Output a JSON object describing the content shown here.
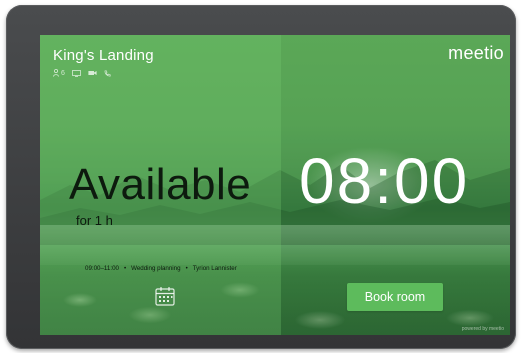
{
  "room": {
    "name": "King's Landing",
    "amenities": [
      {
        "icon": "person-icon",
        "text": "6"
      },
      {
        "icon": "screen-icon",
        "text": ""
      },
      {
        "icon": "camera-icon",
        "text": ""
      },
      {
        "icon": "phone-icon",
        "text": ""
      }
    ]
  },
  "status": {
    "label": "Available",
    "duration": "for 1 h"
  },
  "next_meeting": {
    "time": "09:00–11:00",
    "title": "Wedding planning",
    "organizer": "Tyrion Lannister",
    "separator": "•"
  },
  "brand": {
    "logo": "meetio",
    "powered_by": "powered by meetio"
  },
  "clock": {
    "time": "08:00"
  },
  "actions": {
    "book_label": "Book room"
  },
  "colors": {
    "accent": "#5dbb5c",
    "status_text": "#0d1a0e",
    "device_frame": "#3a3b3d"
  }
}
